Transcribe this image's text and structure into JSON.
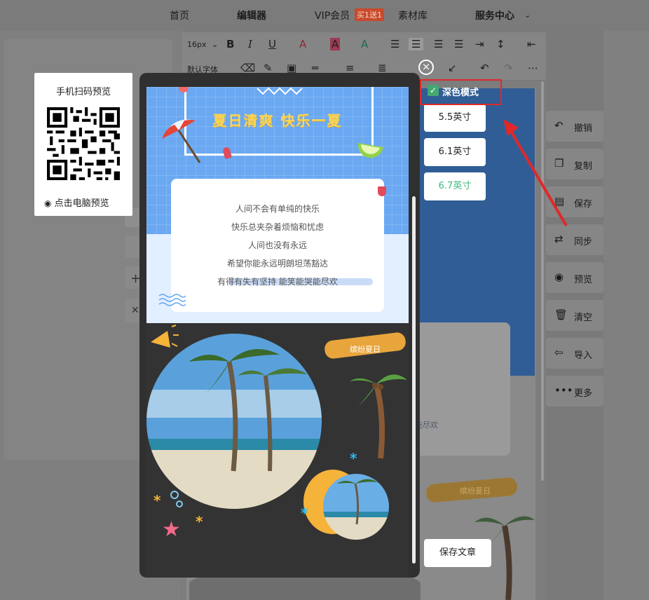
{
  "topnav": {
    "home": "首页",
    "editor": "编辑器",
    "vip": "VIP会员",
    "vip_badge": "买1送1",
    "materials": "素材库",
    "service": "服务中心"
  },
  "toolbar": {
    "font_size": "16px",
    "font_family": "默认字体"
  },
  "qr_preview": {
    "title": "手机扫码预览",
    "pc_preview": "点击电脑预览"
  },
  "phone_preview": {
    "headline": "夏日清爽 快乐一夏",
    "poem": [
      "人间不会有单纯的快乐",
      "快乐总夹杂着烦恼和忧虑",
      "人间也没有永远",
      "希望你能永远明朗坦荡豁达",
      "有得有失有坚持 能笑能哭能尽欢"
    ],
    "brush_label": "缤纷夏日"
  },
  "options": {
    "dark_mode_label": "深色模式",
    "dark_mode_checked": true,
    "sizes": [
      "5.5英寸",
      "6.1英寸",
      "6.7英寸"
    ],
    "selected_size": "6.7英寸",
    "selected_color": "#3dbb7c",
    "save_button": "保存文章"
  },
  "right_tools": [
    {
      "icon": "undo-icon",
      "label": "撤销"
    },
    {
      "icon": "copy-icon",
      "label": "复制"
    },
    {
      "icon": "save-icon",
      "label": "保存"
    },
    {
      "icon": "sync-icon",
      "label": "同步"
    },
    {
      "icon": "eye-icon",
      "label": "预览"
    },
    {
      "icon": "trash-icon",
      "label": "清空"
    },
    {
      "icon": "import-icon",
      "label": "导入"
    },
    {
      "icon": "more-icon",
      "label": "更多"
    }
  ],
  "background_article": {
    "brush_label": "缤纷夏日",
    "text_fragment": "能尽欢"
  },
  "annotation": {
    "highlight_color": "#e0282a"
  }
}
